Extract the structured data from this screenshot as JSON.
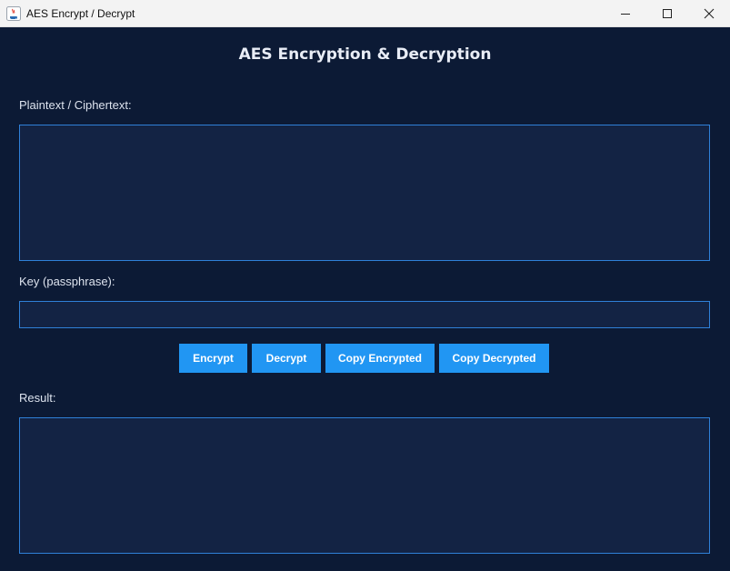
{
  "window": {
    "title": "AES Encrypt / Decrypt"
  },
  "main": {
    "heading": "AES Encryption & Decryption",
    "plaintext_label": "Plaintext / Ciphertext:",
    "plaintext_value": "",
    "key_label": "Key (passphrase):",
    "key_value": "",
    "result_label": "Result:",
    "result_value": ""
  },
  "buttons": {
    "encrypt": "Encrypt",
    "decrypt": "Decrypt",
    "copy_encrypted": "Copy Encrypted",
    "copy_decrypted": "Copy Decrypted"
  },
  "icons": {
    "app": "java-app-icon",
    "minimize": "minimize-icon",
    "maximize": "maximize-icon",
    "close": "close-icon"
  },
  "colors": {
    "background": "#0c1a35",
    "field_background": "#132344",
    "field_border": "#2f80d8",
    "button": "#2196f3",
    "button_text": "#ffffff",
    "text": "#dde3ee"
  }
}
